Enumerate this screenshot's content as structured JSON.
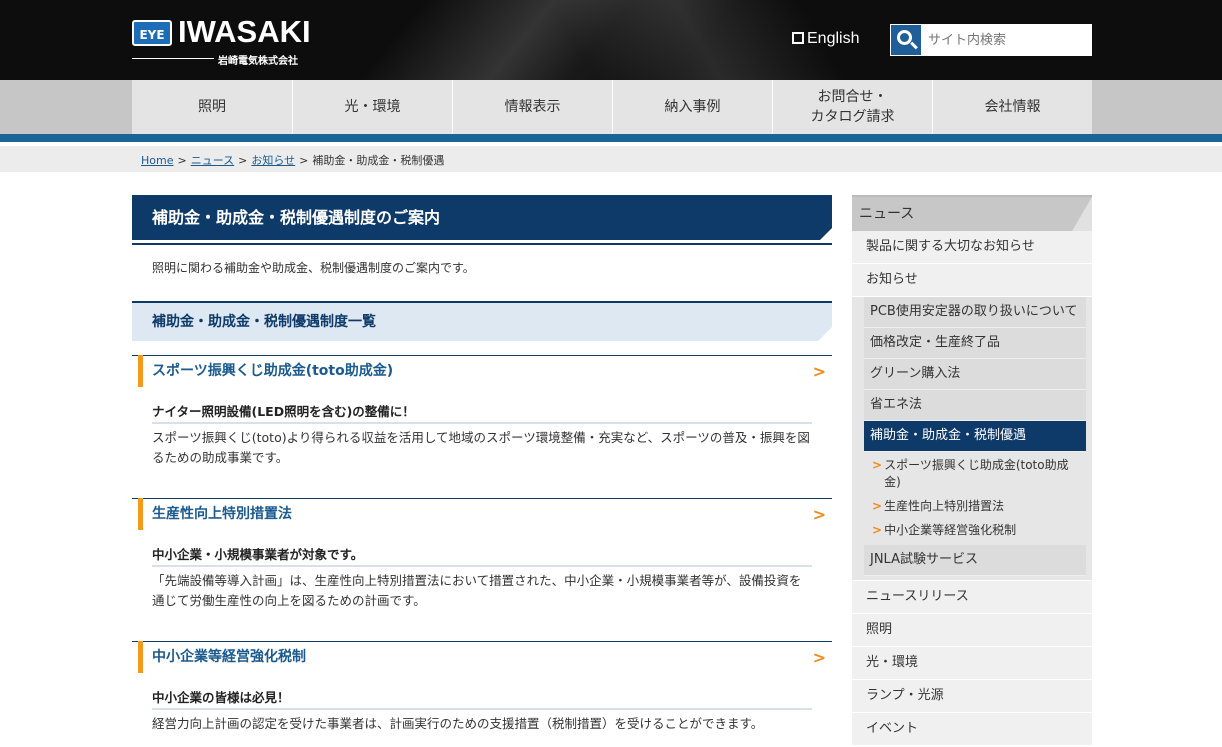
{
  "header": {
    "logo_mark": "EYE",
    "logo_text": "IWASAKI",
    "logo_sub": "岩崎電気株式会社",
    "lang_label": "English",
    "search_placeholder": "サイト内検索"
  },
  "gnav": [
    {
      "label": "照明"
    },
    {
      "label": "光・環境"
    },
    {
      "label": "情報表示"
    },
    {
      "label": "納入事例"
    },
    {
      "label": "お問合せ・\nカタログ請求"
    },
    {
      "label": "会社情報"
    }
  ],
  "breadcrumb": {
    "home": "Home",
    "news": "ニュース",
    "notice": "お知らせ",
    "current": "補助金・助成金・税制優遇",
    "separator": ">"
  },
  "main": {
    "title": "補助金・助成金・税制優遇制度のご案内",
    "intro": "照明に関わる補助金や助成金、税制優遇制度のご案内です。",
    "section_title": "補助金・助成金・税制優遇制度一覧",
    "entries": [
      {
        "title": "スポーツ振興くじ助成金(toto助成金)",
        "subtitle": "ナイター照明設備(LED照明を含む)の整備に！",
        "description": "スポーツ振興くじ(toto)より得られる収益を活用して地域のスポーツ環境整備・充実など、スポーツの普及・振興を図るための助成事業です。"
      },
      {
        "title": "生産性向上特別措置法",
        "subtitle": "中小企業・小規模事業者が対象です。",
        "description": "「先端設備等導入計画」は、生産性向上特別措置法において措置された、中小企業・小規模事業者等が、設備投資を通じて労働生産性の向上を図るための計画です。"
      },
      {
        "title": "中小企業等経営強化税制",
        "subtitle": "中小企業の皆様は必見！",
        "description": "経営力向上計画の認定を受けた事業者は、計画実行のための支援措置（税制措置）を受けることができます。"
      }
    ],
    "arrow": ">"
  },
  "sidebar": {
    "head": "ニュース",
    "item_important": "製品に関する大切なお知らせ",
    "item_notice": "お知らせ",
    "notice_children": [
      {
        "label": "PCB使用安定器の取り扱いについて",
        "active": false
      },
      {
        "label": "価格改定・生産終了品",
        "active": false
      },
      {
        "label": "グリーン購入法",
        "active": false
      },
      {
        "label": "省エネ法",
        "active": false
      },
      {
        "label": "補助金・助成金・税制優遇",
        "active": true
      }
    ],
    "subsidy_children": [
      "スポーツ振興くじ助成金(toto助成金)",
      "生産性向上特別措置法",
      "中小企業等経営強化税制"
    ],
    "jnla": "JNLA試験サービス",
    "bottom_items": [
      "ニュースリリース",
      "照明",
      "光・環境",
      "ランプ・光源",
      "イベント"
    ]
  },
  "colors": {
    "navy": "#0e3a6a",
    "accent_orange": "#f39a1e",
    "nav_blue": "#1b6497"
  }
}
